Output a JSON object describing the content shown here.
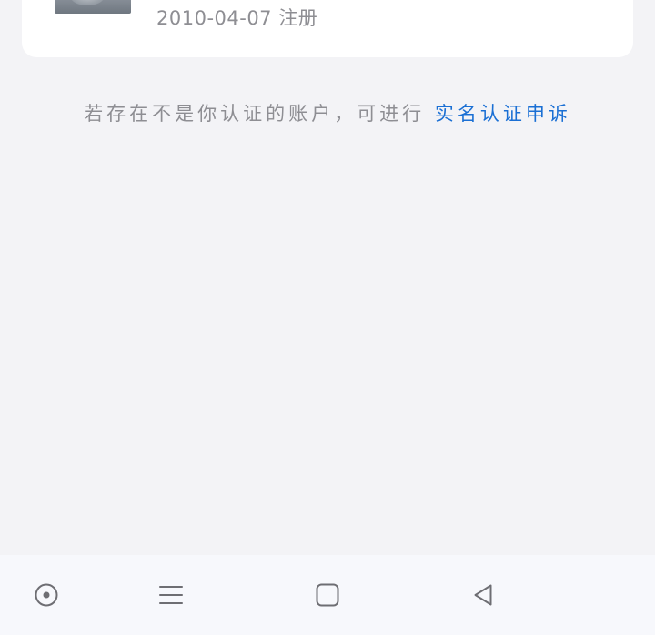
{
  "profile": {
    "registration": "2010-04-07 注册"
  },
  "notice": {
    "prefix": "若存在不是你认证的账户，可进行",
    "link": "实名认证申诉"
  },
  "system_nav": {
    "buttons": [
      "circle-dot-icon",
      "menu-icon",
      "home-square-icon",
      "back-triangle-icon"
    ]
  }
}
